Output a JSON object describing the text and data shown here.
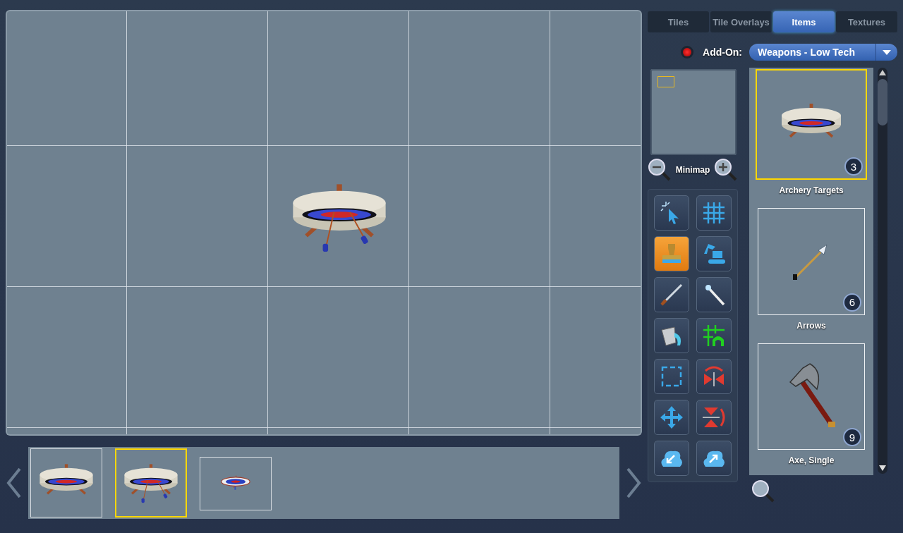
{
  "tabs": [
    {
      "label": "Tiles",
      "selected": false
    },
    {
      "label": "Tile Overlays",
      "selected": false
    },
    {
      "label": "Items",
      "selected": true
    },
    {
      "label": "Textures",
      "selected": false
    }
  ],
  "addon": {
    "label": "Add-On:",
    "value": "Weapons - Low Tech"
  },
  "minimap": {
    "label": "Minimap"
  },
  "tools": [
    {
      "kind": "select",
      "selected": false
    },
    {
      "kind": "grid",
      "selected": false
    },
    {
      "kind": "stamp",
      "selected": true
    },
    {
      "kind": "excavator",
      "selected": false
    },
    {
      "kind": "brush",
      "selected": false
    },
    {
      "kind": "wand",
      "selected": false
    },
    {
      "kind": "bucket",
      "selected": false
    },
    {
      "kind": "wall",
      "selected": false
    },
    {
      "kind": "marquee",
      "selected": false
    },
    {
      "kind": "flip-horizontal",
      "selected": false
    },
    {
      "kind": "move",
      "selected": false
    },
    {
      "kind": "flip-vertical",
      "selected": false
    },
    {
      "kind": "import",
      "selected": false
    },
    {
      "kind": "export",
      "selected": false
    }
  ],
  "items": [
    {
      "name": "Archery Targets",
      "count": "3",
      "kind": "target",
      "selected": true
    },
    {
      "name": "Arrows",
      "count": "6",
      "kind": "arrow",
      "selected": false
    },
    {
      "name": "Axe, Single",
      "count": "9",
      "kind": "axe",
      "selected": false
    }
  ],
  "variants": [
    {
      "kind": "stone",
      "selected": false
    },
    {
      "kind": "stone-arrows",
      "selected": true
    },
    {
      "kind": "flat",
      "selected": false
    }
  ]
}
